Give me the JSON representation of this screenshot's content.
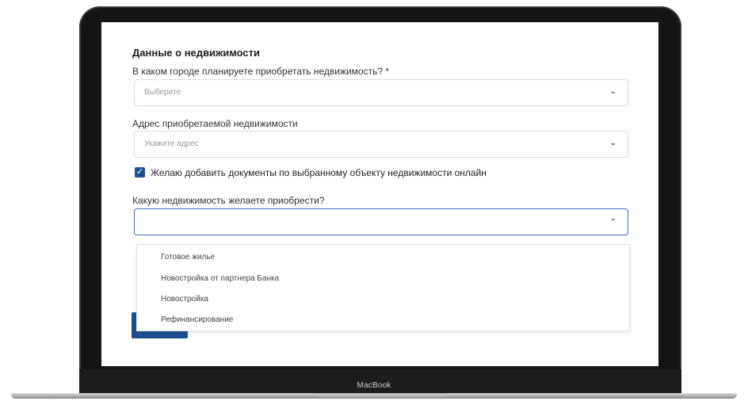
{
  "device": {
    "brand": "MacBook"
  },
  "form": {
    "title": "Данные о недвижимости",
    "city": {
      "label": "В каком городе планируете приобретать недвижимость? *",
      "placeholder": "Выберите"
    },
    "address": {
      "label": "Адрес приобретаемой недвижимости",
      "placeholder": "Укажите адрес"
    },
    "docs_checkbox": {
      "label": "Желаю добавить документы по выбранному  объекту недвижимости онлайн",
      "checked": true
    },
    "property_type": {
      "label": "Какую недвижимость желаете приобрести?",
      "value": "",
      "options": [
        "Готовое жилье",
        "Новостройка от партнера Банка",
        "Новостройка",
        "Рефинансирование"
      ]
    }
  },
  "icons": {
    "chevron_down": "chevron-down-icon",
    "chevron_up": "chevron-up-icon",
    "check": "checkmark-icon"
  },
  "colors": {
    "accent": "#1e4f94",
    "focus_border": "#3a6fb0"
  }
}
